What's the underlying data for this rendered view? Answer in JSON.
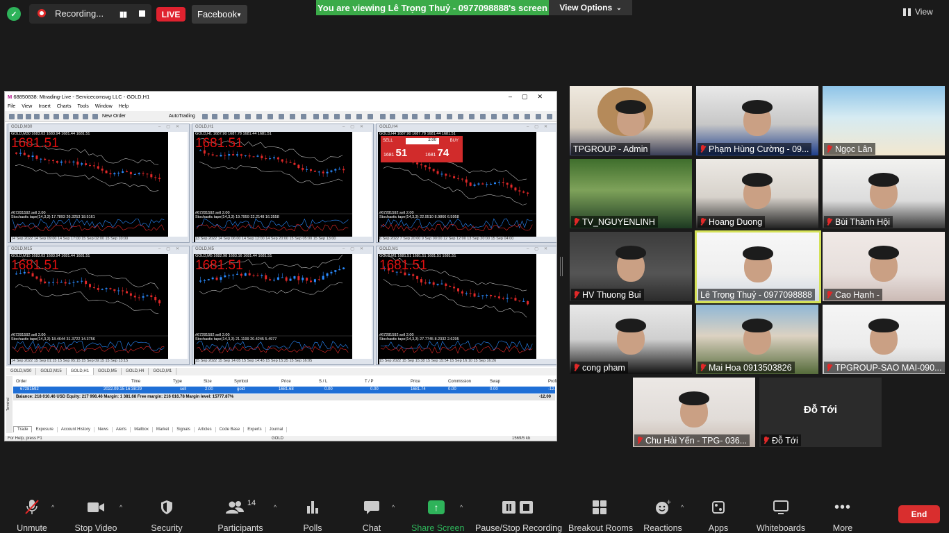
{
  "topbar": {
    "recording_label": "Recording...",
    "live_label": "LIVE",
    "stream_target": "Facebook",
    "viewing_banner": "You are viewing Lê Trọng Thuỷ - 0977098888's screen",
    "view_options": "View Options",
    "view_label": "View"
  },
  "mt5": {
    "title": "68850838: Mtrading-Live - Servicecomsvg LLC - GOLD,H1",
    "menu": [
      "File",
      "View",
      "Insert",
      "Charts",
      "Tools",
      "Window",
      "Help"
    ],
    "new_order": "New Order",
    "autotrading": "AutoTrading",
    "charts": [
      {
        "tab": "GOLD,M30",
        "info": "GOLD,M30  1683.03 1683.94 1681.44 1681.51",
        "price": "1681.51",
        "sell": "#67281592 sell 2.00",
        "stoch": "Stochastic tape(14,3,3) 17.7893 26.3253 18.5161",
        "dates": "14 Sep 2022   14 Sep 09:00   14 Sep 17:00   15 Sep 02:00   15 Sep 10:00"
      },
      {
        "tab": "GOLD,H1",
        "info": "GOLD,H1  1687.90 1687.78 1681.44 1681.51",
        "price": "1681.51",
        "sell": "#67281592 sell 2.00",
        "stoch": "Stochastic tape(14,3,3) 19.7959 22.2148 16.3558",
        "dates": "13 Sep 2022   14 Sep 06:00   14 Sep 12:00   14 Sep 20:00   15 Sep 05:00   15 Sep 13:00"
      },
      {
        "tab": "GOLD,H4",
        "info": "GOLD,H4  1687.90 1687.78 1681.44 1681.51",
        "price": "",
        "sell": "#67281592 sell 2.00",
        "stoch": "Stochastic tape(14,3,3) 22.9510 8.9866 6.5958",
        "dates": "6 Sep 2022   7 Sep 20:00   9 Sep 00:00   12 Sep 12:00   13 Sep 20:00   15 Sep 04:00"
      },
      {
        "tab": "GOLD,M15",
        "info": "GOLD,M15  1683.03 1683.94 1681.44 1681.51",
        "price": "1681.51",
        "sell": "#67281592 sell 2.00",
        "stoch": "Stochastic tape(14,3,3) 18.4644 31.3722 14.3756",
        "dates": "14 Sep 2022   15 Sep 01:15   15 Sep 05:15   15 Sep 09:15   15 Sep 13:15"
      },
      {
        "tab": "GOLD,M5",
        "info": "GOLD,M5  1682.98 1683.16 1681.44 1681.51",
        "price": "1681.51",
        "sell": "#67281592 sell 2.00",
        "stoch": "Stochastic tape(14,3,3) 21.1199 20.4245 5.4977",
        "dates": "15 Sep 2022   15 Sep 14:05   15 Sep 14:45   15 Sep 15:25   15 Sep 16:05"
      },
      {
        "tab": "GOLD,M1",
        "info": "GOLD,M1  1681.51 1681.51 1681.51 1681.51",
        "price": "1681.51",
        "sell": "#67281592 sell 2.00",
        "stoch": "Stochastic tape(14,3,3) 27.7745 8.2332 2.6295",
        "dates": "15 Sep 2022   15 Sep 15:38   15 Sep 15:54   15 Sep 16:10   15 Sep 16:26"
      }
    ],
    "oneclick": {
      "sell": "SELL",
      "buy": "BUY",
      "qty": "2.00",
      "bid_small": "1681",
      "bid_big": "51",
      "ask_small": "1681",
      "ask_big": "74"
    },
    "chart_tabs": [
      "GOLD,M30",
      "GOLD,M15",
      "GOLD,H1",
      "GOLD,M5",
      "GOLD,H4",
      "GOLD,M1"
    ],
    "terminal": {
      "headers": [
        "Order",
        "Time",
        "Type",
        "Size",
        "Symbol",
        "Price",
        "S / L",
        "T / P",
        "Price",
        "Commission",
        "Swap",
        "Profit"
      ],
      "row": [
        "67281592",
        "2022.09.15 16:38:29",
        "sell",
        "2.00",
        "gold",
        "1681.68",
        "0.00",
        "0.00",
        "1681.74",
        "0.00",
        "0.00",
        "-12.00"
      ],
      "balance": "Balance: 218 010.46 USD  Equity: 217 998.46  Margin: 1 381.68  Free margin: 216 616.78  Margin level: 15777.87%",
      "balance_profit": "-12.00",
      "tabs": [
        "Trade",
        "Exposure",
        "Account History",
        "News",
        "Alerts",
        "Mailbox",
        "Market",
        "Signals",
        "Articles",
        "Code Base",
        "Experts",
        "Journal"
      ],
      "side_label": "Terminal"
    },
    "status": {
      "help": "For Help, press F1",
      "symbol": "GOLD",
      "speed": "1569/5 kb"
    }
  },
  "participants": [
    {
      "name": "TPGROUP - Admin",
      "muted": false
    },
    {
      "name": "Phạm Hùng Cường - 09...",
      "muted": true
    },
    {
      "name": "Ngọc Lân",
      "muted": true
    },
    {
      "name": "TV_NGUYENLINH",
      "muted": true
    },
    {
      "name": "Hoang Duong",
      "muted": true
    },
    {
      "name": "Bùi Thành Hội",
      "muted": true
    },
    {
      "name": "HV Thuong Bui",
      "muted": true
    },
    {
      "name": "Lê Trọng Thuỷ - 0977098888",
      "muted": false
    },
    {
      "name": "Cao Hạnh -",
      "muted": true
    },
    {
      "name": "cong pham",
      "muted": true
    },
    {
      "name": "Mai Hoa 0913503826",
      "muted": true
    },
    {
      "name": "TPGROUP-SAO MAI-090...",
      "muted": true
    },
    {
      "name": "Chu Hải Yến - TPG- 036...",
      "muted": true
    },
    {
      "name": "Đỗ Tới",
      "muted": true
    }
  ],
  "no_video_name": "Đỗ Tới",
  "toolbar": {
    "unmute": "Unmute",
    "stop_video": "Stop Video",
    "security": "Security",
    "participants": "Participants",
    "participants_count": "14",
    "polls": "Polls",
    "chat": "Chat",
    "share_screen": "Share Screen",
    "pause_recording": "Pause/Stop Recording",
    "breakout": "Breakout Rooms",
    "reactions": "Reactions",
    "apps": "Apps",
    "whiteboards": "Whiteboards",
    "more": "More",
    "end": "End"
  }
}
